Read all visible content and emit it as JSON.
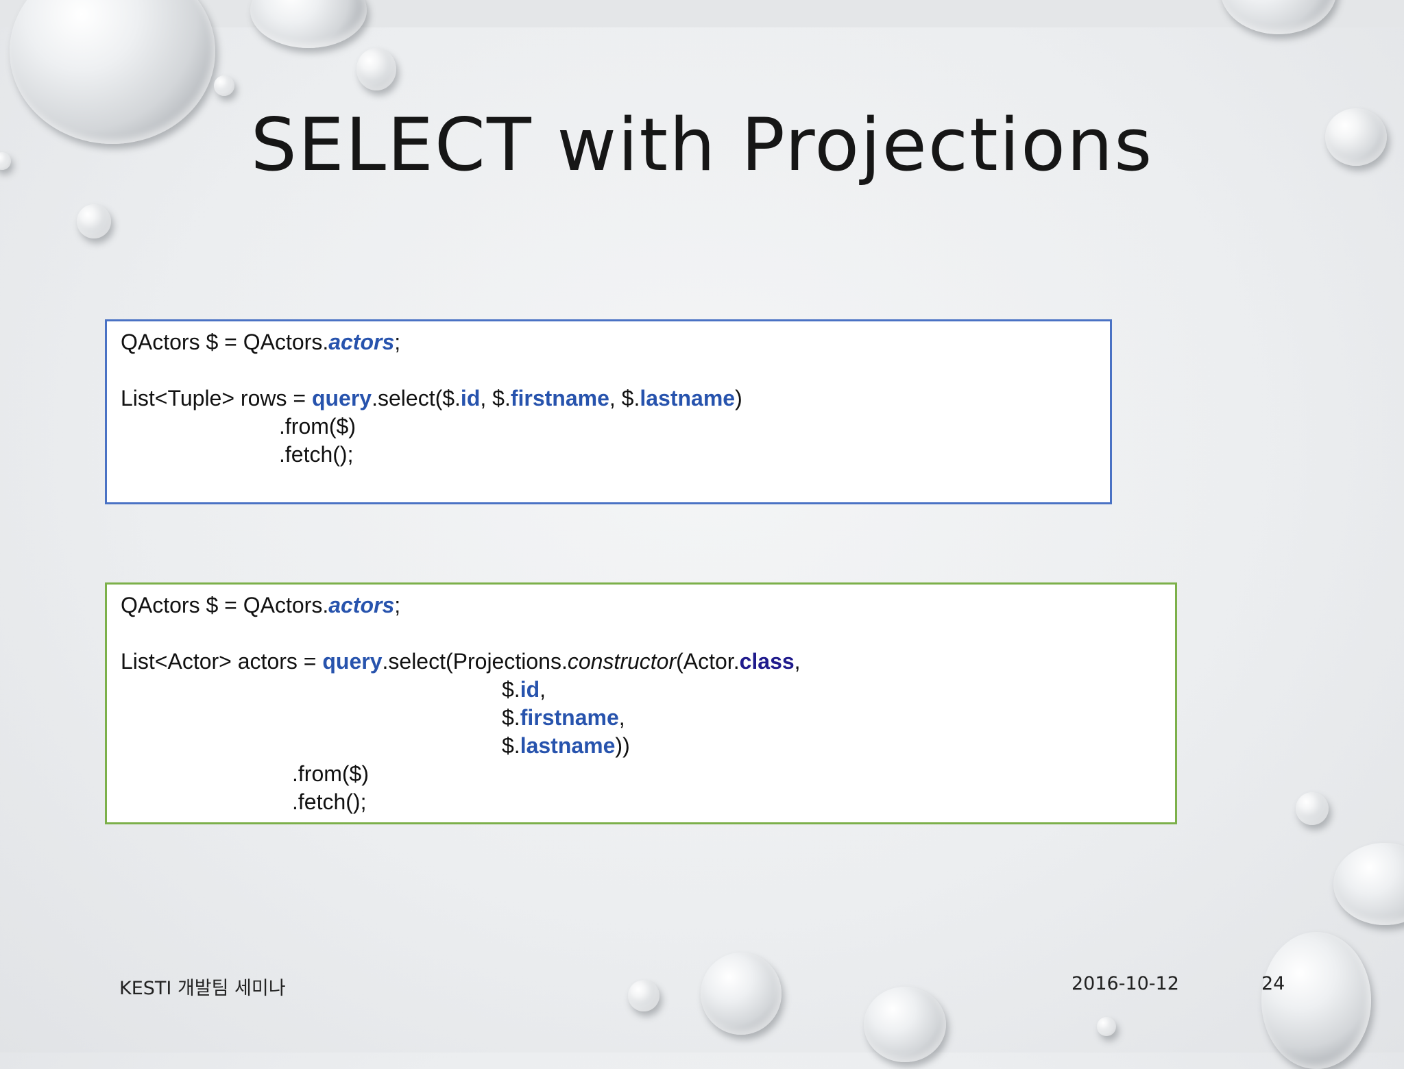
{
  "slide": {
    "title": "SELECT with Projections"
  },
  "code_blocks": [
    {
      "line1": {
        "a": "QActors $ = QActors.",
        "b": "actors",
        "c": ";"
      },
      "line3": {
        "a": "List<Tuple> rows = ",
        "b": "query",
        "c": ".select($.",
        "d": "id",
        "e": ", $.",
        "f": "firstname",
        "g": ", $.",
        "h": "lastname",
        "i": ")"
      },
      "line4": ".from($)",
      "line5": ".fetch();"
    },
    {
      "line1": {
        "a": "QActors $ = QActors.",
        "b": "actors",
        "c": ";"
      },
      "line3": {
        "a": "List<Actor> actors = ",
        "b": "query",
        "c": ".select(Projections.",
        "d": "constructor",
        "e": "(Actor.",
        "f": "class",
        "g": ","
      },
      "line4": {
        "a": "$.",
        "b": "id",
        "c": ","
      },
      "line5": {
        "a": "$.",
        "b": "firstname",
        "c": ","
      },
      "line6": {
        "a": "$.",
        "b": "lastname",
        "c": "))"
      },
      "line7": ".from($)",
      "line8": ".fetch();"
    }
  ],
  "footer": {
    "left": "KESTI 개발팀 세미나",
    "date": "2016-10-12",
    "page": "24"
  },
  "colors": {
    "keyword": "#2753ad",
    "class_keyword": "#1f1a8c",
    "box1_border": "#4a72c4",
    "box2_border": "#7cb04a"
  }
}
